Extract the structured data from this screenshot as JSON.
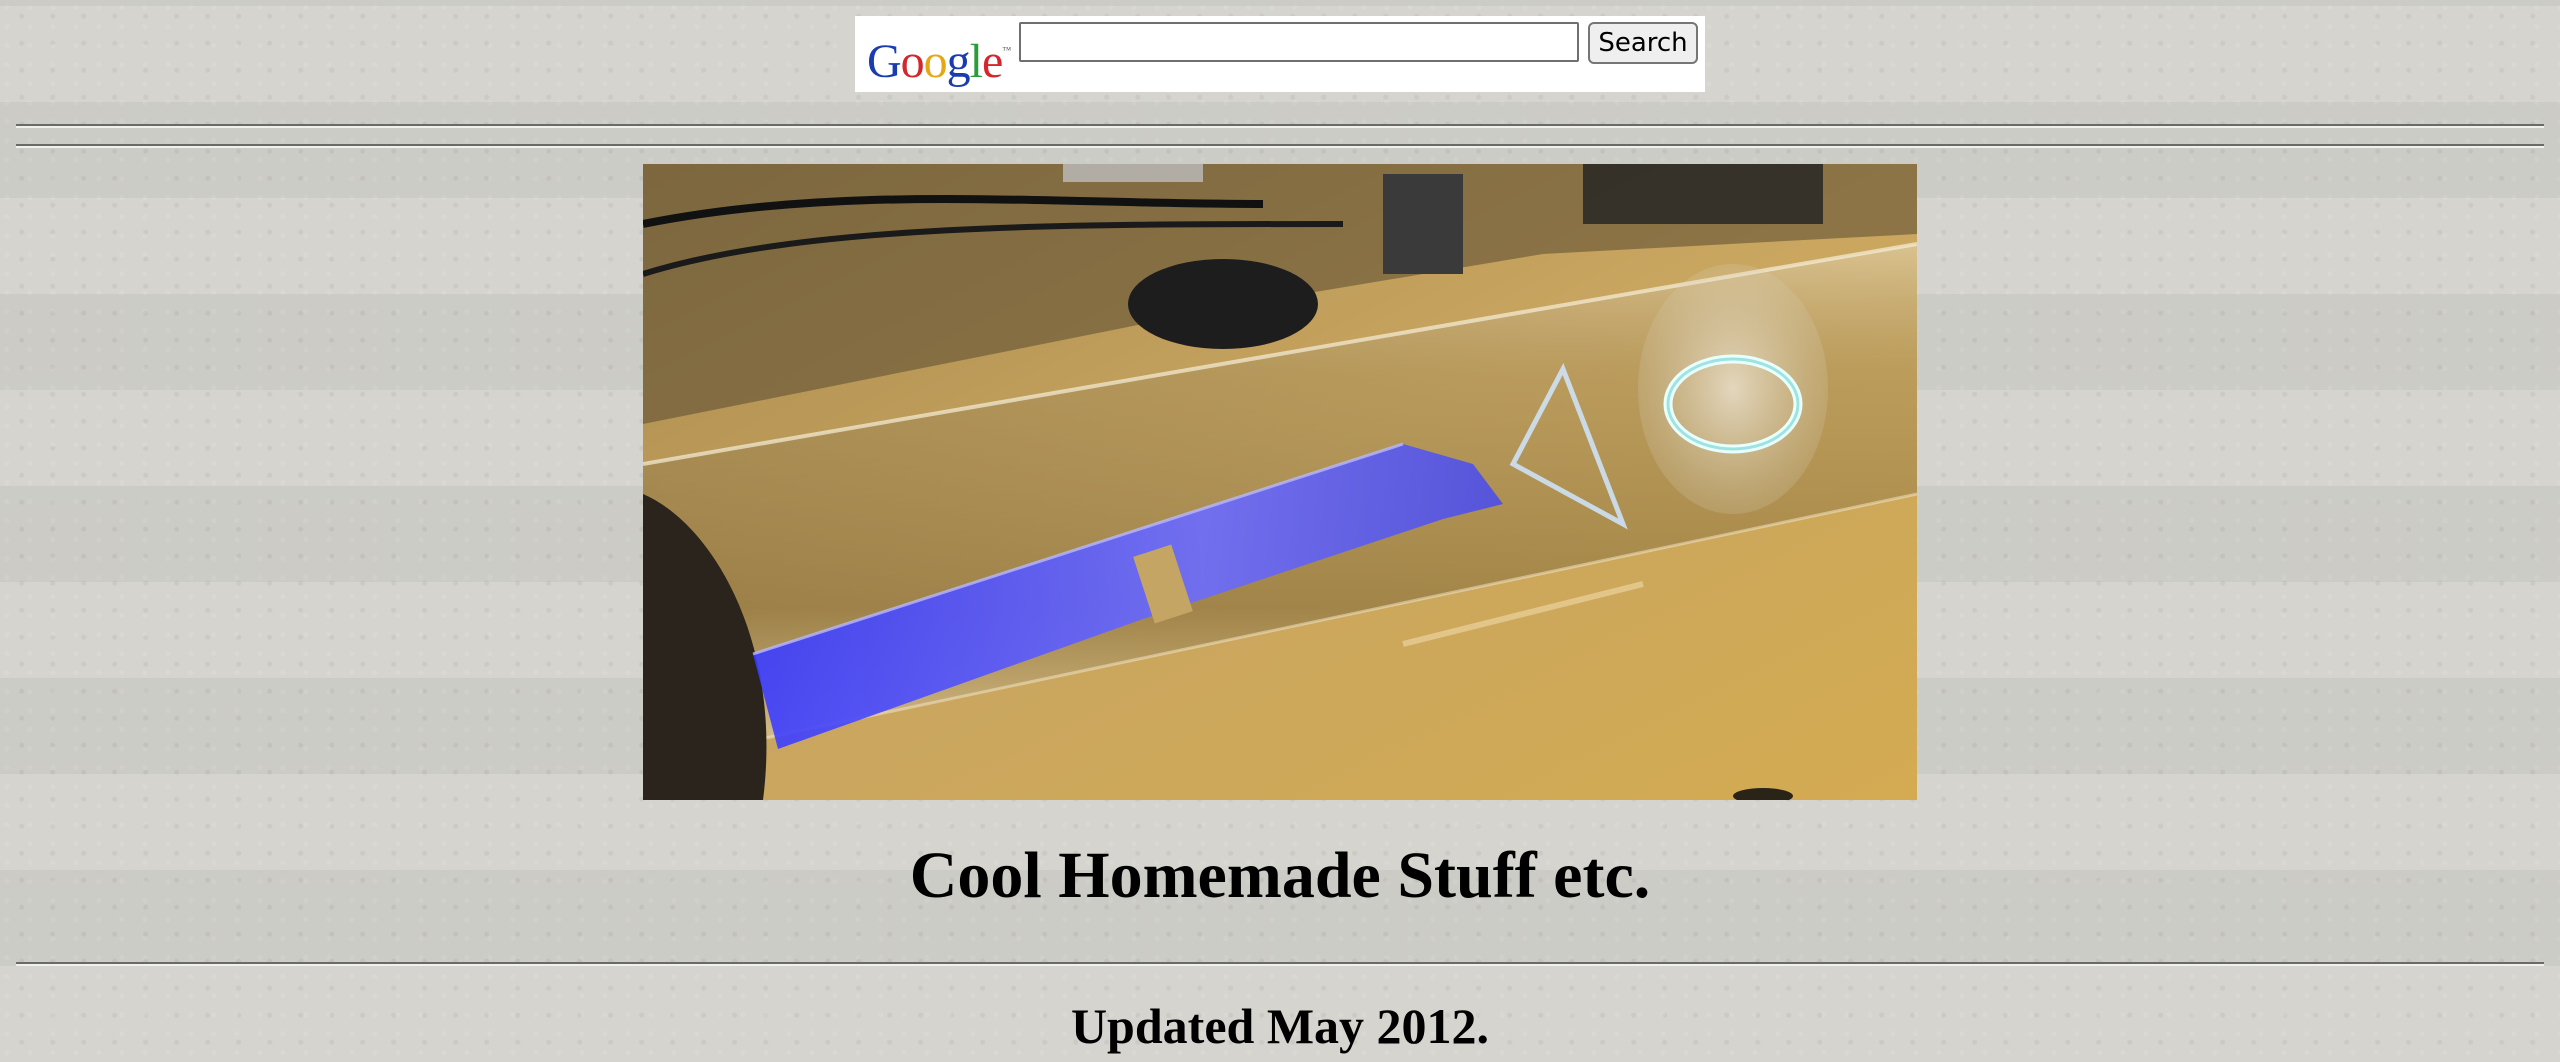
{
  "search": {
    "logo_text": "Google",
    "logo_letters": [
      "G",
      "o",
      "o",
      "g",
      "l",
      "e"
    ],
    "logo_colors": [
      "#1a3cb0",
      "#d3262d",
      "#e5a814",
      "#1a3cb0",
      "#2c9c3a",
      "#d3262d"
    ],
    "trademark": "™",
    "input_value": "",
    "button_label": "Search"
  },
  "hero_image": {
    "alt": "Homemade glass vacuum tube glowing blue with a triangle and ring inside",
    "icon": "photo"
  },
  "page": {
    "title": "Cool Homemade Stuff etc.",
    "updated": "Updated May 2012."
  }
}
